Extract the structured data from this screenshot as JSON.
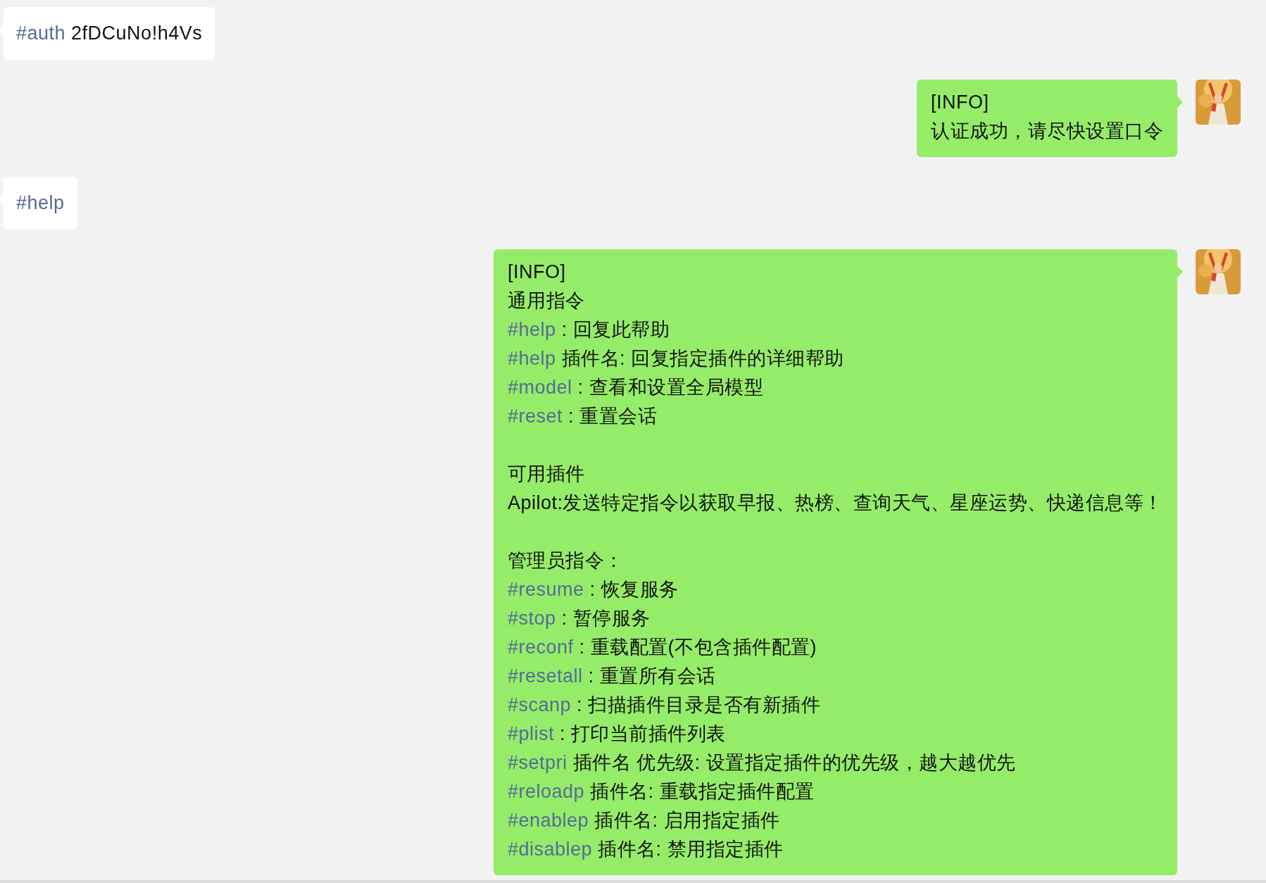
{
  "messages": [
    {
      "kind": "incoming",
      "paragraphs": [
        [
          {
            "tag": "#auth",
            "text": " 2fDCuNo!h4Vs"
          }
        ]
      ]
    },
    {
      "kind": "outgoing",
      "paragraphs": [
        [
          {
            "text": "[INFO]"
          },
          {
            "text": "认证成功，请尽快设置口令"
          }
        ]
      ]
    },
    {
      "kind": "incoming",
      "paragraphs": [
        [
          {
            "tag": "#help"
          }
        ]
      ]
    },
    {
      "kind": "outgoing",
      "paragraphs": [
        [
          {
            "text": "[INFO]"
          },
          {
            "text": "通用指令"
          },
          {
            "tag": "#help",
            "text": " : 回复此帮助"
          },
          {
            "tag": "#help",
            "text": " 插件名: 回复指定插件的详细帮助"
          },
          {
            "tag": "#model",
            "text": " : 查看和设置全局模型"
          },
          {
            "tag": "#reset",
            "text": " : 重置会话"
          }
        ],
        [
          {
            "text": "可用插件"
          },
          {
            "text": "Apilot:发送特定指令以获取早报、热榜、查询天气、星座运势、快递信息等！"
          }
        ],
        [
          {
            "text": "管理员指令："
          },
          {
            "tag": "#resume",
            "text": " : 恢复服务"
          },
          {
            "tag": "#stop",
            "text": " : 暂停服务"
          },
          {
            "tag": "#reconf",
            "text": " : 重载配置(不包含插件配置)"
          },
          {
            "tag": "#resetall",
            "text": " : 重置所有会话"
          },
          {
            "tag": "#scanp",
            "text": " : 扫描插件目录是否有新插件"
          },
          {
            "tag": "#plist",
            "text": " : 打印当前插件列表"
          },
          {
            "tag": "#setpri",
            "text": " 插件名 优先级: 设置指定插件的优先级，越大越优先"
          },
          {
            "tag": "#reloadp",
            "text": " 插件名: 重载指定插件配置"
          },
          {
            "tag": "#enablep",
            "text": " 插件名: 启用指定插件"
          },
          {
            "tag": "#disablep",
            "text": " 插件名: 禁用指定插件"
          }
        ]
      ]
    }
  ]
}
